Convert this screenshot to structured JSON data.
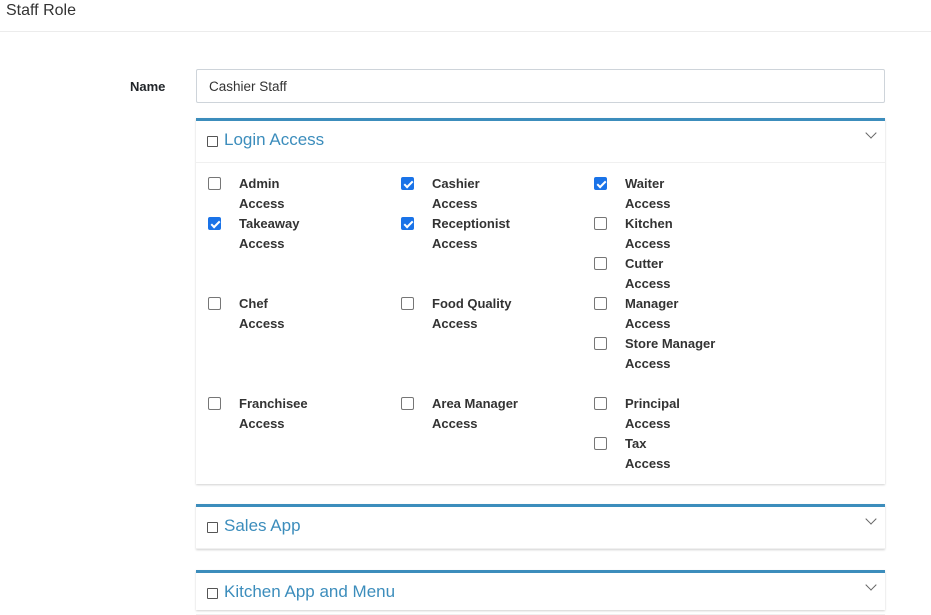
{
  "page": {
    "title": "Staff Role"
  },
  "form": {
    "name_label": "Name",
    "name_value": "Cashier Staff"
  },
  "sections": [
    {
      "title": "Login Access",
      "permissions": [
        {
          "label": "Admin Access",
          "checked": false
        },
        {
          "label": "Cashier Access",
          "checked": true
        },
        {
          "label": "Waiter Access",
          "checked": true
        },
        {
          "label": "Takeaway Access",
          "checked": true
        },
        {
          "label": "Receptionist Access",
          "checked": true
        },
        {
          "label": "Kitchen Access",
          "checked": false
        },
        {
          "label": "Cutter Access",
          "checked": false
        },
        {
          "label": "Chef Access",
          "checked": false
        },
        {
          "label": "Food Quality Access",
          "checked": false
        },
        {
          "label": "Manager Access",
          "checked": false
        },
        {
          "label": "Store Manager Access",
          "checked": false
        },
        {
          "label": "Franchisee Access",
          "checked": false
        },
        {
          "label": "Area Manager Access",
          "checked": false
        },
        {
          "label": "Principal Access",
          "checked": false
        },
        {
          "label": "Tax Access",
          "checked": false
        }
      ]
    },
    {
      "title": "Sales App"
    },
    {
      "title": "Kitchen App and Menu"
    }
  ],
  "colors": {
    "accent": "#3c8dbc",
    "checkbox_checked": "#1a73e8"
  }
}
